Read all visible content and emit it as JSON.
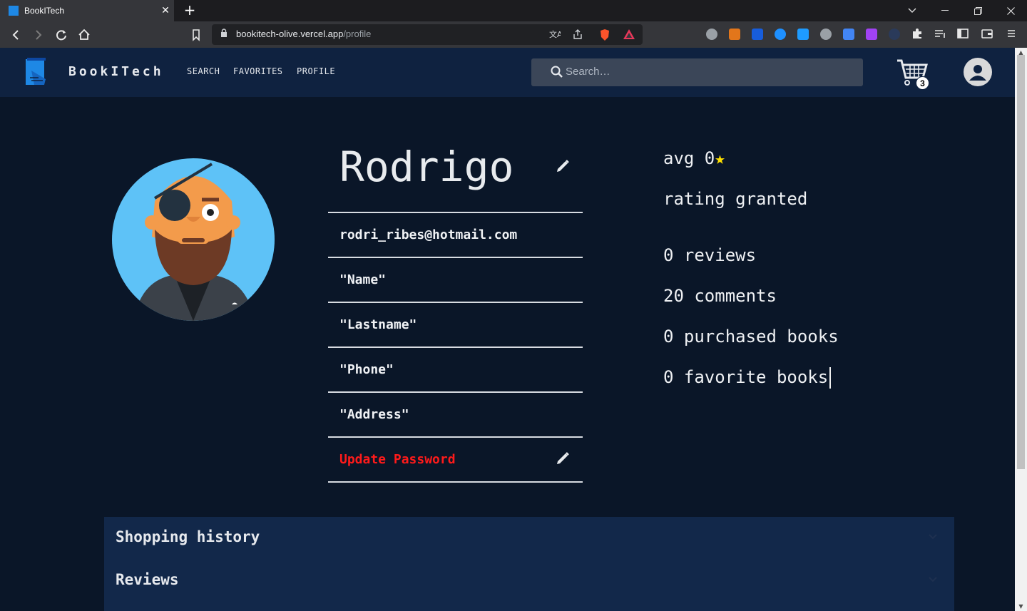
{
  "browser": {
    "tab_title": "BookITech",
    "tab_close": "✕",
    "new_tab": "+",
    "url_host": "bookitech-olive.vercel.app",
    "url_path": "/profile"
  },
  "header": {
    "brand": "BookITech",
    "nav": [
      "SEARCH",
      "FAVORITES",
      "PROFILE"
    ],
    "search_placeholder": "Search…",
    "cart_count": "3"
  },
  "profile": {
    "username": "Rodrigo",
    "fields": [
      "rodri_ribes@hotmail.com",
      "\"Name\"",
      "\"Lastname\"",
      "\"Phone\"",
      "\"Address\""
    ],
    "update_password": "Update Password"
  },
  "stats": {
    "avg": "avg 0",
    "rating": "rating granted",
    "reviews": "0 reviews",
    "comments": "20 comments",
    "purchased": "0 purchased books",
    "favorites": "0 favorite books"
  },
  "accordion": [
    "Shopping history",
    "Reviews"
  ],
  "colors": {
    "page_bg": "#0a1628",
    "header_bg": "#0f2240",
    "accent_red": "#ff1a1a",
    "star": "#ffe000"
  }
}
